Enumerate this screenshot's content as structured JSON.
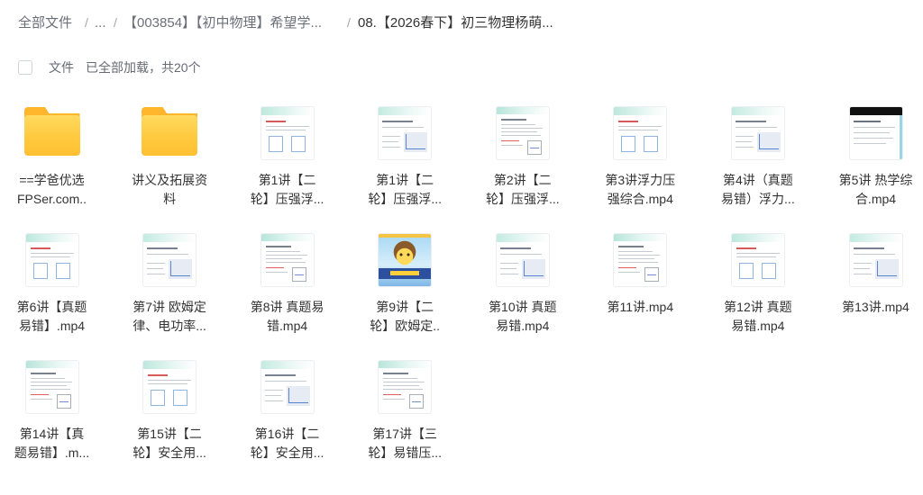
{
  "breadcrumb": {
    "separator": "/",
    "items": [
      {
        "label": "全部文件"
      },
      {
        "label": "..."
      },
      {
        "label": "【003854】【初中物理】希望学..."
      },
      {
        "label": "08.【2026春下】初三物理杨萌..."
      }
    ]
  },
  "list_header": {
    "select_all_checked": false,
    "label": "文件",
    "status": "已全部加载，共20个"
  },
  "files": {
    "items": [
      {
        "icon": "folder-icon",
        "lines": [
          "==学爸优选",
          "FPSer.com.."
        ]
      },
      {
        "icon": "folder-icon",
        "lines": [
          "讲义及拓展资",
          "料"
        ]
      },
      {
        "icon": "video-thumbnail",
        "lines": [
          "第1讲【二",
          "轮】压强浮..."
        ]
      },
      {
        "icon": "video-thumbnail",
        "lines": [
          "第1讲【二",
          "轮】压强浮..."
        ]
      },
      {
        "icon": "video-thumbnail",
        "lines": [
          "第2讲【二",
          "轮】压强浮..."
        ]
      },
      {
        "icon": "video-thumbnail",
        "lines": [
          "第3讲浮力压",
          "强综合.mp4"
        ]
      },
      {
        "icon": "video-thumbnail",
        "lines": [
          "第4讲（真题",
          "易错）浮力..."
        ]
      },
      {
        "icon": "video-thumbnail",
        "lines": [
          "第5讲 热学综",
          "合.mp4"
        ]
      },
      {
        "icon": "video-thumbnail",
        "lines": [
          "第6讲【真题",
          "易错】.mp4"
        ]
      },
      {
        "icon": "video-thumbnail",
        "lines": [
          "第7讲 欧姆定",
          "律、电功率..."
        ]
      },
      {
        "icon": "video-thumbnail",
        "lines": [
          "第8讲 真题易",
          "错.mp4"
        ]
      },
      {
        "icon": "video-thumbnail",
        "lines": [
          "第9讲【二",
          "轮】欧姆定.."
        ]
      },
      {
        "icon": "video-thumbnail",
        "lines": [
          "第10讲 真题",
          "易错.mp4"
        ]
      },
      {
        "icon": "video-thumbnail",
        "lines": [
          "第11讲.mp4"
        ]
      },
      {
        "icon": "video-thumbnail",
        "lines": [
          "第12讲 真题",
          "易错.mp4"
        ]
      },
      {
        "icon": "video-thumbnail",
        "lines": [
          "第13讲.mp4"
        ]
      },
      {
        "icon": "video-thumbnail",
        "lines": [
          "第14讲【真",
          "题易错】.m..."
        ]
      },
      {
        "icon": "video-thumbnail",
        "lines": [
          "第15讲【二",
          "轮】安全用..."
        ]
      },
      {
        "icon": "video-thumbnail",
        "lines": [
          "第16讲【二",
          "轮】安全用..."
        ]
      },
      {
        "icon": "video-thumbnail",
        "lines": [
          "第17讲【三",
          "轮】易错压..."
        ]
      }
    ]
  }
}
